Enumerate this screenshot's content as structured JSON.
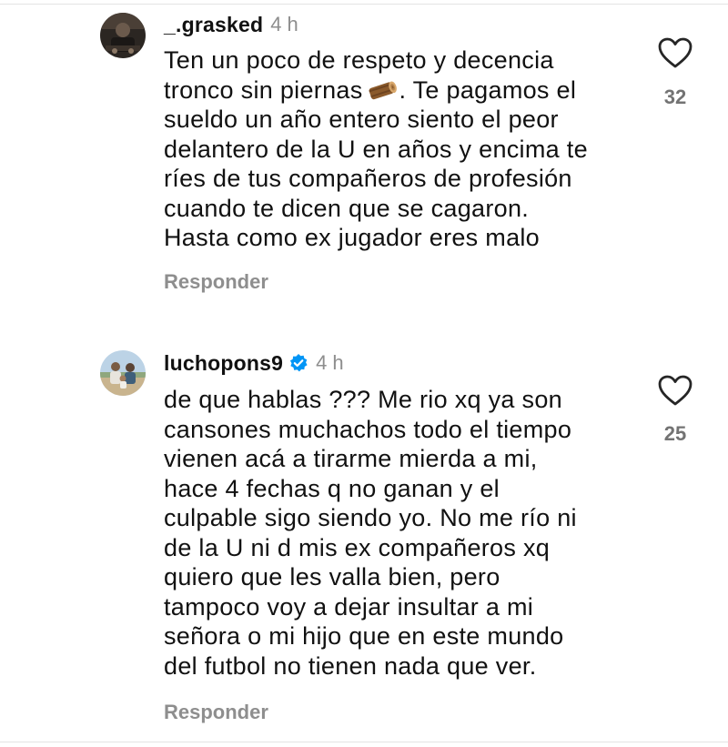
{
  "comments": [
    {
      "username": "_.grasked",
      "time": "4 h",
      "verified": false,
      "lines": [
        "Ten un poco de respeto y decencia",
        "tronco sin piernas",
        ". Te pagamos el",
        "sueldo un año entero siento el peor",
        "delantero de la U en años y encima te",
        "ríes de tus compañeros de profesión",
        "cuando te dicen que se cagaron.",
        "Hasta como ex jugador eres malo"
      ],
      "emoji": "log",
      "likes": "32",
      "reply_label": "Responder"
    },
    {
      "username": "luchopons9",
      "time": "4 h",
      "verified": true,
      "lines": [
        "de que hablas ??? Me rio xq ya son",
        "cansones muchachos todo el tiempo",
        "vienen acá a tirarme mierda a mi,",
        "hace 4 fechas q no ganan y el",
        "culpable sigo siendo yo. No me río ni",
        "de la U ni d mis ex compañeros xq",
        "quiero que les valla bien, pero",
        "tampoco voy a dejar insultar a mi",
        "señora o mi hijo que en este mundo",
        "del futbol no tienen nada que ver."
      ],
      "likes": "25",
      "reply_label": "Responder"
    }
  ],
  "icons": {
    "like": "heart-outline-icon",
    "verified": "verified-badge-icon",
    "emoji": "wood-log-emoji"
  },
  "colors": {
    "text": "#111111",
    "muted": "#8e8e8e",
    "verified_blue": "#0095f6"
  }
}
